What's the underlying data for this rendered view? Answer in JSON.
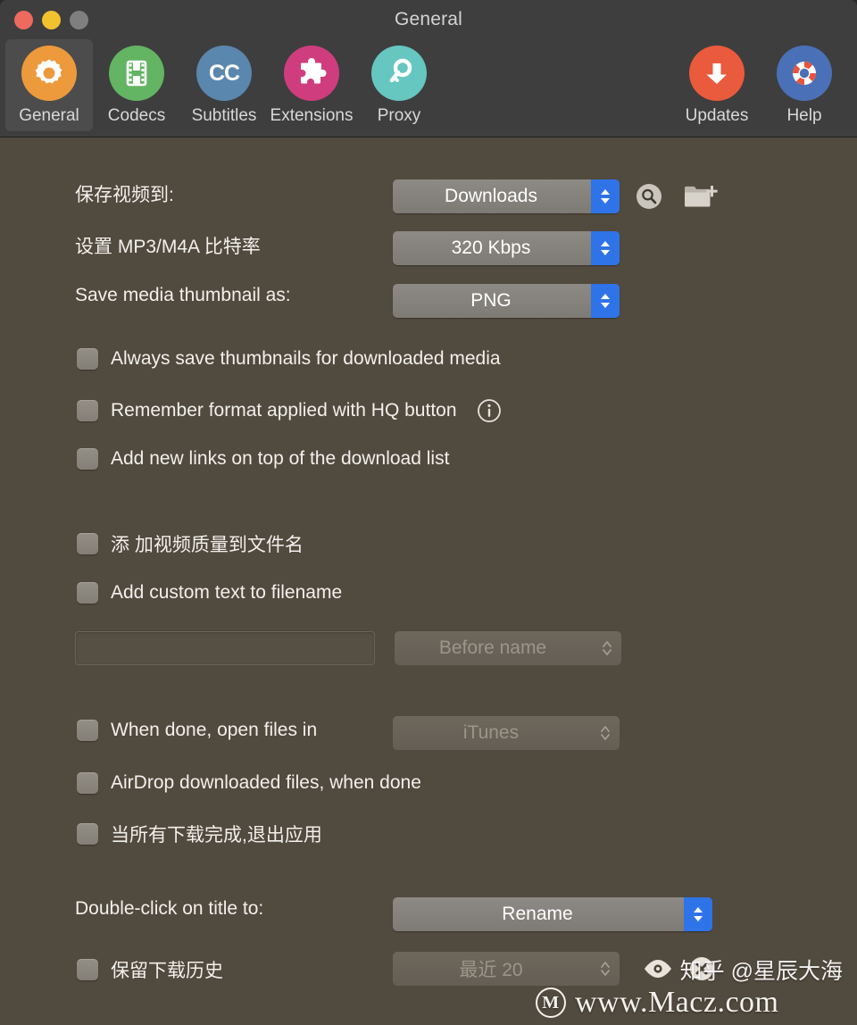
{
  "window": {
    "title": "General",
    "traffic_lights": [
      "close",
      "minimize",
      "zoom"
    ]
  },
  "toolbar": {
    "items": [
      {
        "id": "general",
        "label": "General",
        "icon": "gear-icon",
        "color": "#ec9a3c",
        "selected": true
      },
      {
        "id": "codecs",
        "label": "Codecs",
        "icon": "film-strip-icon",
        "color": "#63b463",
        "selected": false
      },
      {
        "id": "subtitles",
        "label": "Subtitles",
        "icon": "cc-icon",
        "color": "#5a87ae",
        "selected": false
      },
      {
        "id": "extensions",
        "label": "Extensions",
        "icon": "puzzle-piece-icon",
        "color": "#cf3d7e",
        "selected": false
      },
      {
        "id": "proxy",
        "label": "Proxy",
        "icon": "key-icon",
        "color": "#66c6c0",
        "selected": false
      }
    ],
    "right_items": [
      {
        "id": "updates",
        "label": "Updates",
        "icon": "download-arrow-icon",
        "color": "#ea5a3c"
      },
      {
        "id": "help",
        "label": "Help",
        "icon": "life-ring-icon",
        "color": "#4a71b8"
      }
    ]
  },
  "settings": {
    "save_video_to": {
      "label": "保存视频到:",
      "value": "Downloads",
      "enabled": true,
      "search_icon": "magnifier-icon",
      "new_folder_icon": "new-folder-icon"
    },
    "mp3_bitrate": {
      "label": "设置 MP3/M4A 比特率",
      "value": "320 Kbps",
      "enabled": true
    },
    "thumbnail_format": {
      "label": "Save media thumbnail as:",
      "value": "PNG",
      "enabled": true
    },
    "checkboxes_group1": [
      {
        "id": "always-save-thumbnails",
        "label": "Always save thumbnails for downloaded media",
        "checked": false
      },
      {
        "id": "remember-hq-format",
        "label": "Remember format applied with HQ button",
        "checked": false,
        "info_icon": "info-icon"
      },
      {
        "id": "add-new-links-on-top",
        "label": "Add new links on top of the download list",
        "checked": false
      }
    ],
    "checkboxes_group2": [
      {
        "id": "add-quality-to-filename",
        "label": "添 加视频质量到文件名",
        "checked": false
      },
      {
        "id": "add-custom-text",
        "label": "Add custom text to filename",
        "checked": false
      }
    ],
    "custom_text": {
      "value": "",
      "placeholder": "",
      "position_value": "Before name",
      "enabled": false
    },
    "when_done_open": {
      "label": "When done, open files in",
      "checked": false,
      "value": "iTunes",
      "enabled": false
    },
    "airdrop": {
      "label": "AirDrop downloaded files, when done",
      "checked": false
    },
    "quit_when_done": {
      "label": "当所有下载完成,退出应用",
      "checked": false
    },
    "double_click": {
      "label": "Double-click on title to:",
      "value": "Rename",
      "enabled": true
    },
    "keep_history": {
      "label": "保留下载历史",
      "checked": false,
      "value": "最近 20",
      "enabled": false,
      "eye_icon": "eye-icon",
      "clear_icon": "clear-circle-icon"
    }
  },
  "watermarks": {
    "macz": "www.Macz.com",
    "macz_logo": "M",
    "zhihu": "知乎 @星辰大海"
  }
}
